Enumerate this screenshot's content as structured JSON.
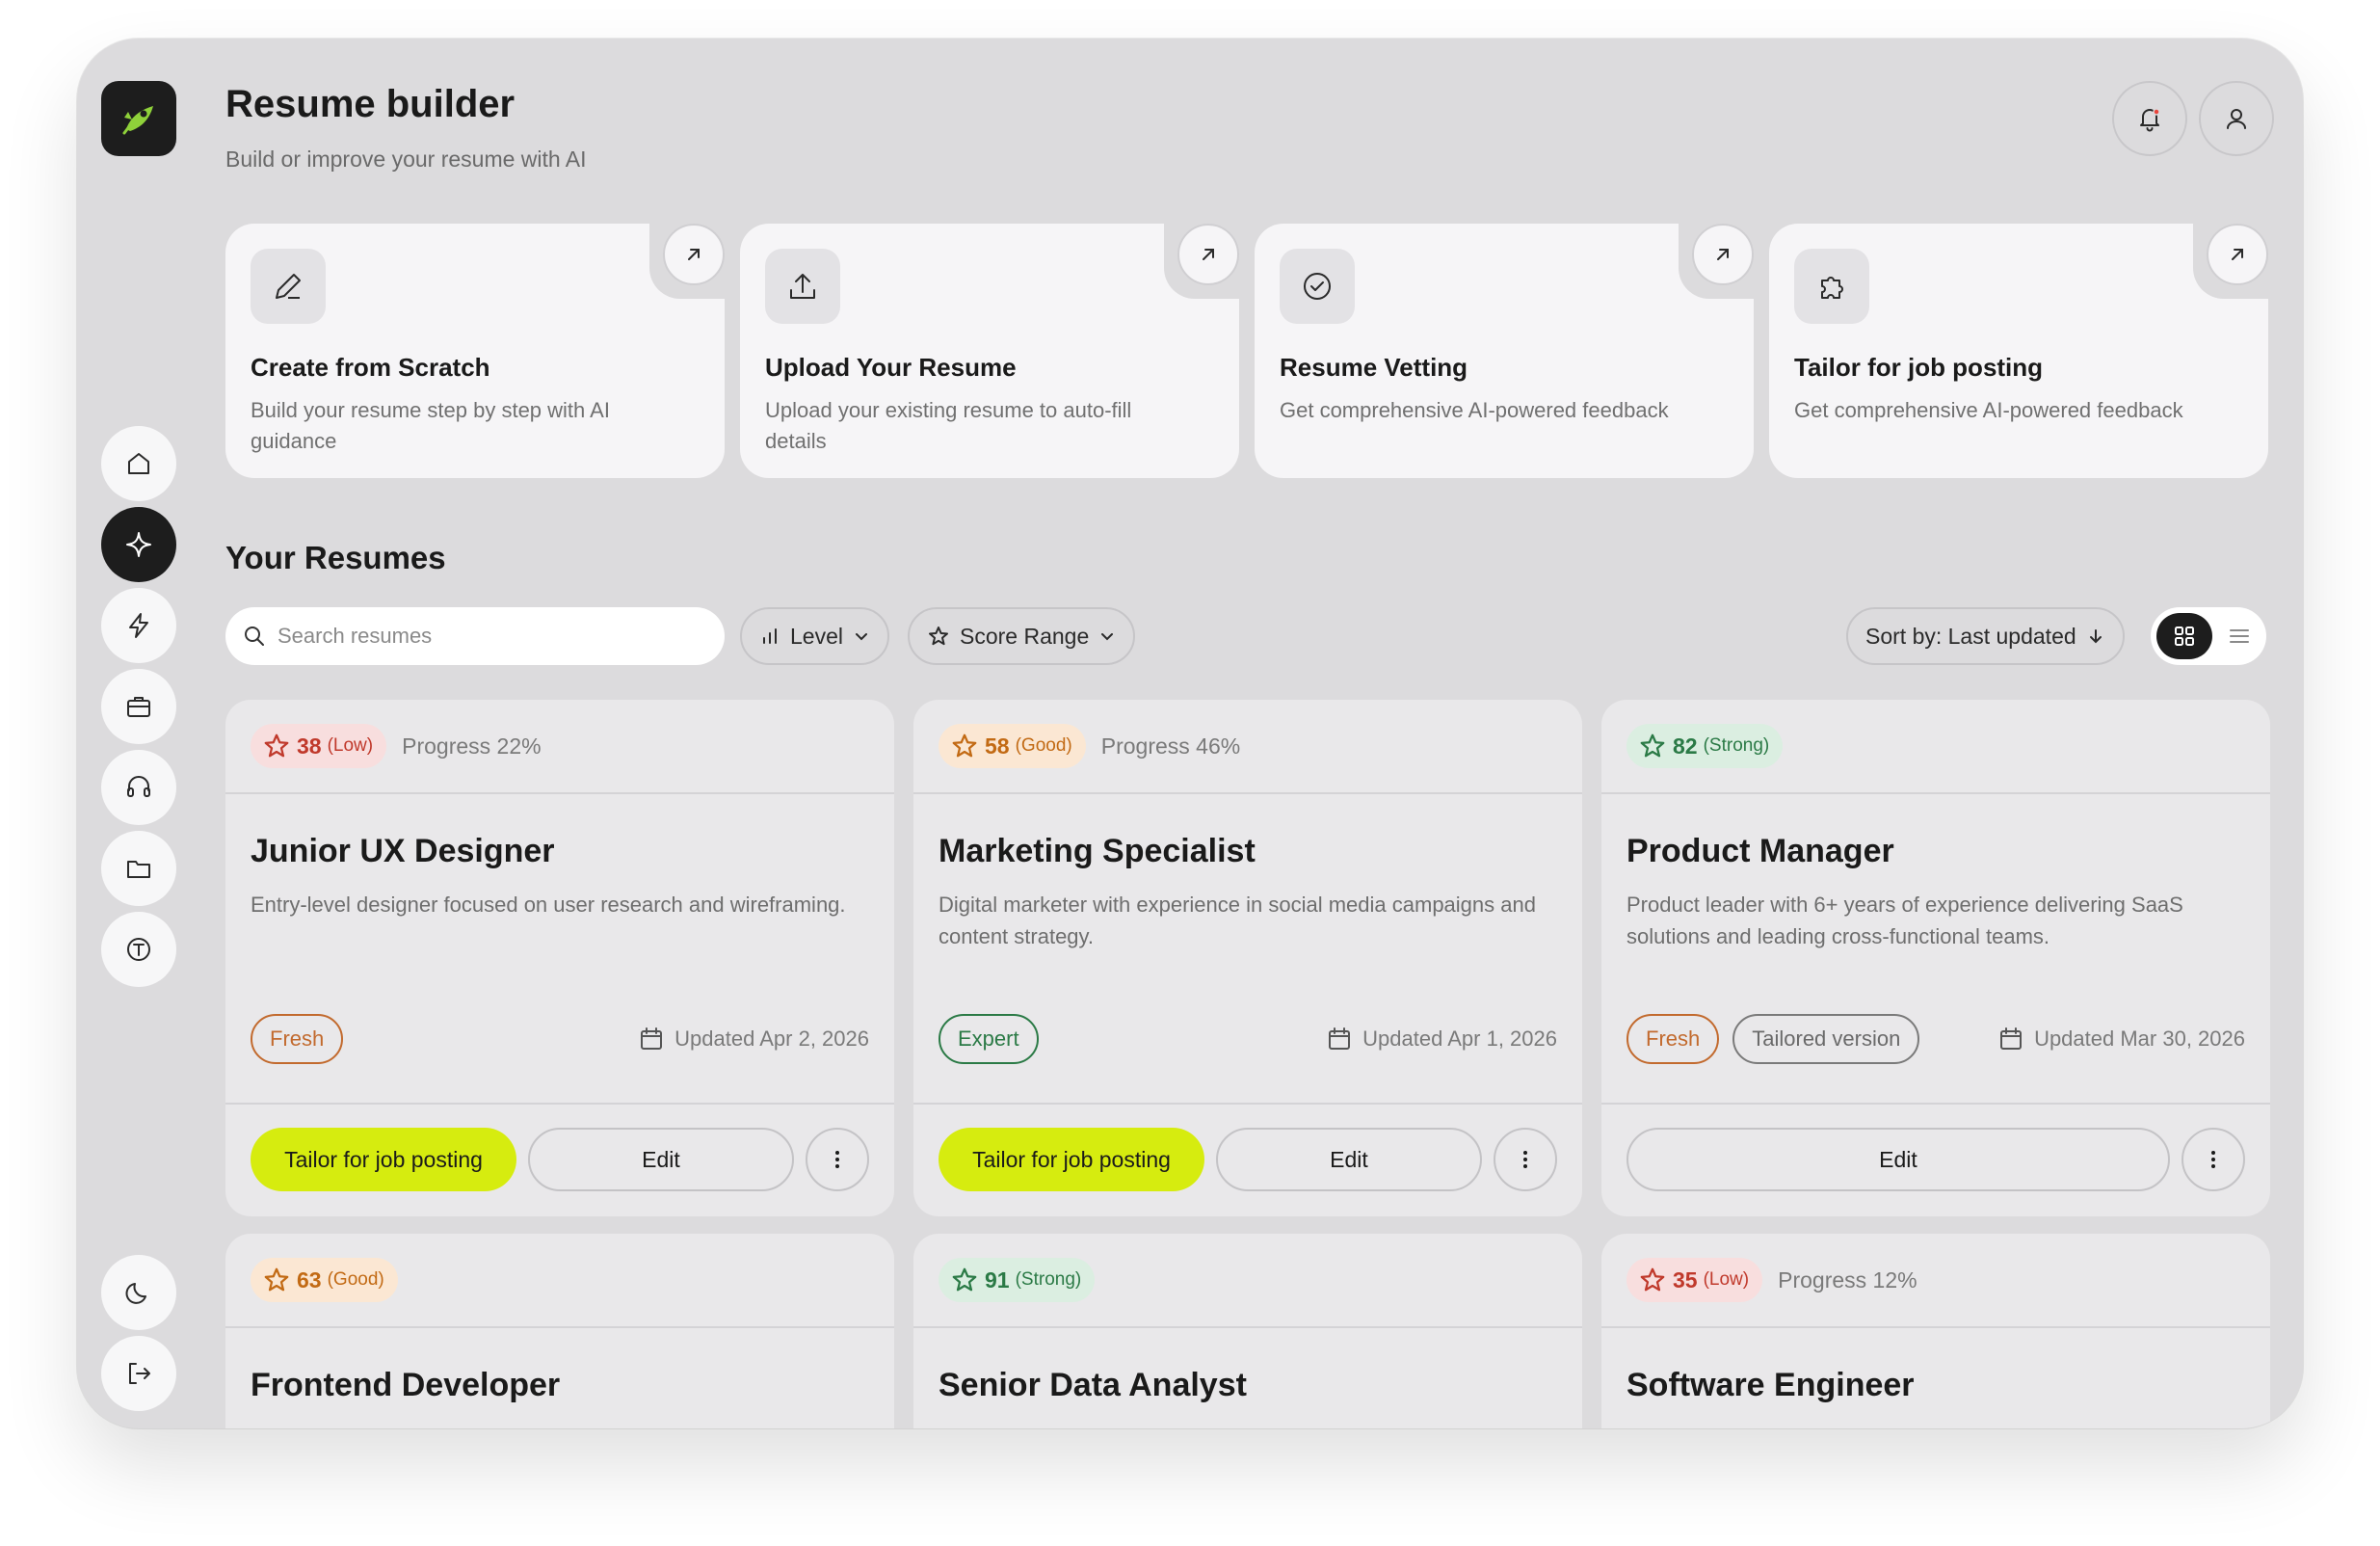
{
  "header": {
    "title": "Resume builder",
    "subtitle": "Build or improve your resume with AI"
  },
  "icons": {
    "logo": "rocket-logo",
    "notifications": "bell-icon",
    "profile": "user-icon",
    "sidebar": [
      "home-icon",
      "sparkle-icon",
      "bolt-icon",
      "briefcase-icon",
      "headset-icon",
      "folder-icon",
      "text-icon"
    ],
    "sidebar_bottom": [
      "moon-icon",
      "logout-icon"
    ]
  },
  "colors": {
    "accent": "#d6ec0f",
    "low": "#c0392b",
    "good": "#c26a14",
    "strong": "#2b7a46",
    "notification_dot": "#e8453c"
  },
  "quick_actions": [
    {
      "title": "Create from Scratch",
      "description": "Build your resume step by step with AI guidance",
      "icon": "pencil-icon"
    },
    {
      "title": "Upload Your Resume",
      "description": "Upload your existing resume to auto-fill details",
      "icon": "upload-icon"
    },
    {
      "title": "Resume Vetting",
      "description": "Get comprehensive AI-powered feedback",
      "icon": "check-circle-icon"
    },
    {
      "title": "Tailor for job posting",
      "description": "Get comprehensive AI-powered feedback",
      "icon": "puzzle-icon"
    }
  ],
  "resumes_section": {
    "title": "Your Resumes",
    "search_placeholder": "Search resumes",
    "filters": {
      "level": "Level",
      "score_range": "Score Range"
    },
    "sort_label": "Sort by: Last updated"
  },
  "resumes": [
    {
      "score": "38",
      "level": "(Low)",
      "progress": "Progress 22%",
      "title": "Junior UX Designer",
      "description": "Entry-level designer focused on user research and wireframing.",
      "tags": [
        "Fresh"
      ],
      "updated": "Updated Apr 2, 2026",
      "tailor_label": "Tailor for job posting",
      "edit_label": "Edit"
    },
    {
      "score": "58",
      "level": "(Good)",
      "progress": "Progress 46%",
      "title": "Marketing Specialist",
      "description": "Digital marketer with experience in social media campaigns and content strategy.",
      "tags": [
        "Expert"
      ],
      "updated": "Updated Apr 1, 2026",
      "tailor_label": "Tailor for job posting",
      "edit_label": "Edit"
    },
    {
      "score": "82",
      "level": "(Strong)",
      "title": "Product Manager",
      "description": "Product leader with 6+ years of experience delivering SaaS solutions and leading cross-functional teams.",
      "tags": [
        "Fresh",
        "Tailored version"
      ],
      "updated": "Updated Mar 30, 2026",
      "edit_label": "Edit"
    },
    {
      "score": "63",
      "level": "(Good)",
      "title": "Frontend Developer"
    },
    {
      "score": "91",
      "level": "(Strong)",
      "title": "Senior Data Analyst"
    },
    {
      "score": "35",
      "level": "(Low)",
      "progress": "Progress 12%",
      "title": "Software Engineer"
    }
  ]
}
